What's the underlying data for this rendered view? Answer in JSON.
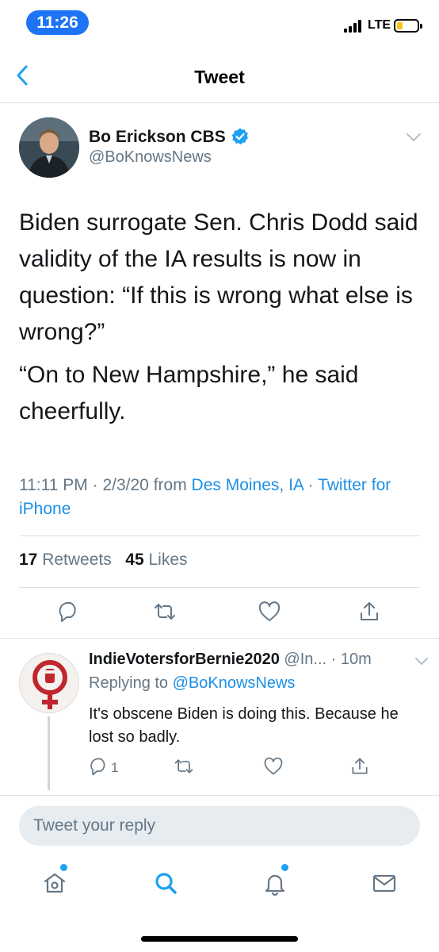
{
  "status_bar": {
    "time": "11:26",
    "network": "LTE",
    "battery_level": 0.25,
    "battery_color": "#f5c518"
  },
  "nav": {
    "title": "Tweet"
  },
  "tweet": {
    "author_name": "Bo Erickson CBS",
    "author_handle": "@BoKnowsNews",
    "text_paragraphs": [
      "Biden surrogate Sen. Chris Dodd said validity of the IA results is now in question: “If this is wrong what else is wrong?”",
      "“On to New Hampshire,” he said cheerfully."
    ],
    "time": "11:11 PM",
    "date": "2/3/20",
    "from_label": "from",
    "location": "Des Moines, IA",
    "client": "Twitter for iPhone",
    "retweets_count": "17",
    "retweets_label": "Retweets",
    "likes_count": "45",
    "likes_label": "Likes"
  },
  "reply": {
    "name": "IndieVotersforBernie2020",
    "handle": "@In...",
    "time": "10m",
    "replying_prefix": "Replying to",
    "replying_to": "@BoKnowsNews",
    "text": "It's obscene Biden is doing this. Because he lost so badly.",
    "reply_count": "1"
  },
  "reply_box": {
    "placeholder": "Tweet your reply"
  },
  "colors": {
    "accent": "#1da1f2",
    "link": "#1d8fe5",
    "time_pill": "#1d74f5",
    "secondary_text": "#657786",
    "reply_avatar_symbol": "#c0262d"
  },
  "icons": {
    "back": "chevron-left-icon",
    "verified": "verified-badge-icon",
    "caret": "chevron-down-icon",
    "reply": "comment-icon",
    "retweet": "retweet-icon",
    "like": "heart-icon",
    "share": "share-icon",
    "home": "home-icon",
    "search": "search-icon",
    "notifications": "bell-icon",
    "messages": "envelope-icon"
  }
}
